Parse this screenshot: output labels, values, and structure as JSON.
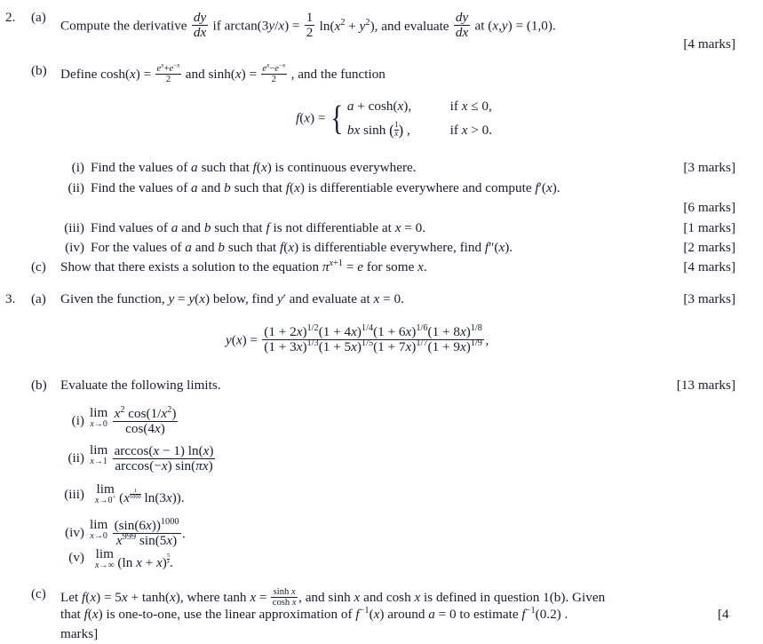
{
  "document": {
    "type": "mathematics-exam-questions",
    "background_color": "#ffffff",
    "text_color": "#1a1a2e"
  },
  "questions": [
    {
      "number": "2.",
      "parts": [
        {
          "label": "(a)",
          "text_before": "Compute the derivative",
          "formula_1": "dy/dx",
          "text_middle": "if arctan(3y/x) =",
          "formula_2": "1/2 ln(x^2 + y^2)",
          "text_after": ", and evaluate",
          "formula_3": "dy/dx",
          "text_end": "at (x, y) = (1, 0).",
          "marks": "[4 marks]"
        },
        {
          "label": "(b)",
          "text": "Define cosh(x) = (e^x + e^-x)/2 and sinh(x) = (e^x - e^-x)/2, and the function",
          "function_definition": {
            "name": "f(x) =",
            "case_1_value": "a + cosh(x),",
            "case_1_condition": "if x ≤ 0,",
            "case_2_value": "bx sinh (1/x) ,",
            "case_2_condition": "if x > 0."
          },
          "subparts": [
            {
              "label": "(i)",
              "text": "Find the values of a such that f(x) is continuous everywhere.",
              "marks": "[3 marks]"
            },
            {
              "label": "(ii)",
              "text": "Find the values of a and b such that f(x) is differentiable everywhere and compute f'(x).",
              "marks": "[6 marks]"
            },
            {
              "label": "(iii)",
              "text": "Find values of a and b such that f is not differentiable at x = 0.",
              "marks": "[1 marks]"
            },
            {
              "label": "(iv)",
              "text": "For the values of a and b such that f(x) is differentiable everywhere, find f''(x).",
              "marks": "[2 marks]"
            }
          ]
        },
        {
          "label": "(c)",
          "text": "Show that there exists a solution to the equation π^(x+1) = e for some x.",
          "marks": "[4 marks]"
        }
      ]
    },
    {
      "number": "3.",
      "parts": [
        {
          "label": "(a)",
          "text": "Given the function, y = y(x) below, find y' and evaluate at x = 0.",
          "marks": "[3 marks]",
          "formula": {
            "lhs": "y(x) =",
            "numerator": "(1 + 2x)^{1/2}(1 + 4x)^{1/4}(1 + 6x)^{1/6}(1 + 8x)^{1/8}",
            "denominator": "(1 + 3x)^{1/3}(1 + 5x)^{1/5}(1 + 7x)^{1/7}(1 + 9x)^{1/9}",
            "trailing": ","
          }
        },
        {
          "label": "(b)",
          "text": "Evaluate the following limits.",
          "marks": "[13 marks]",
          "limits": [
            {
              "label": "(i)",
              "operator": "lim",
              "approach": "x→0",
              "numerator": "x^2 cos(1/x^2)",
              "denominator": "cos(4x)",
              "trailing": ""
            },
            {
              "label": "(ii)",
              "operator": "lim",
              "approach": "x→1",
              "numerator": "arccos(x − 1) ln(x)",
              "denominator": "arccos(−x) sin(πx)",
              "trailing": ""
            },
            {
              "label": "(iii)",
              "operator": "lim",
              "approach": "x→0⁺",
              "expression": "(x^{1/1000} ln(3x)).",
              "trailing": "."
            },
            {
              "label": "(iv)",
              "operator": "lim",
              "approach": "x→0",
              "numerator": "(sin(6x))^{1000}",
              "denominator": "x^{999} sin(5x)",
              "trailing": "."
            },
            {
              "label": "(v)",
              "operator": "lim",
              "approach": "x→∞",
              "expression": "(ln x + x)^{5/x}.",
              "trailing": "."
            }
          ]
        },
        {
          "label": "(c)",
          "line_1": "Let f(x) = 5x + tanh(x), where tanh x = sinh x / cosh x, and sinh x and cosh x is defined in question 1(b). Given",
          "line_2": "that f(x) is one-to-one, use the linear approximation of f⁻¹(x) around a = 0 to estimate f⁻¹(0.2) .",
          "line_2_marks": "[4",
          "line_3": "marks]"
        }
      ]
    }
  ]
}
